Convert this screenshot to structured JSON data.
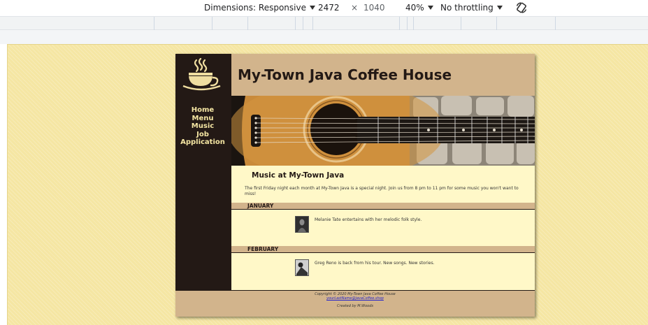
{
  "devtools": {
    "dimensions_label": "Dimensions: Responsive",
    "width_value": "2472",
    "times_symbol": "×",
    "height_value": "1040",
    "zoom_label": "40%",
    "throttling_label": "No throttling",
    "icons": {
      "rotate": "rotate-icon",
      "dropdown": "chevron-down-icon"
    }
  },
  "site": {
    "title": "My-Town Java Coffee House",
    "logo_icon": "coffee-cup-logo",
    "nav": [
      "Home",
      "Menu",
      "Music",
      "Job",
      "Application"
    ],
    "music_heading": "Music at My-Town Java",
    "intro": "The first Friday night each month at My-Town Java is a special night. Join us from 8 pm to 11 pm for some music you won't want to miss!",
    "events": [
      {
        "month": "JANUARY",
        "text": "Melanie Tate entertains with her melodic folk style."
      },
      {
        "month": "FEBRUARY",
        "text": "Greg Reno is back from his tour. New songs. New stories."
      }
    ],
    "footer": {
      "copyright": "Copyright © 2020 My-Town Java Coffee House",
      "email": "yourLastName@javaCoffee.shop",
      "credit": "Created by M.Woods"
    },
    "colors": {
      "dark_brown": "#231915",
      "tan": "#d2b48c",
      "cream": "#fff8c8",
      "page_yellow": "#f5e6a3"
    }
  }
}
